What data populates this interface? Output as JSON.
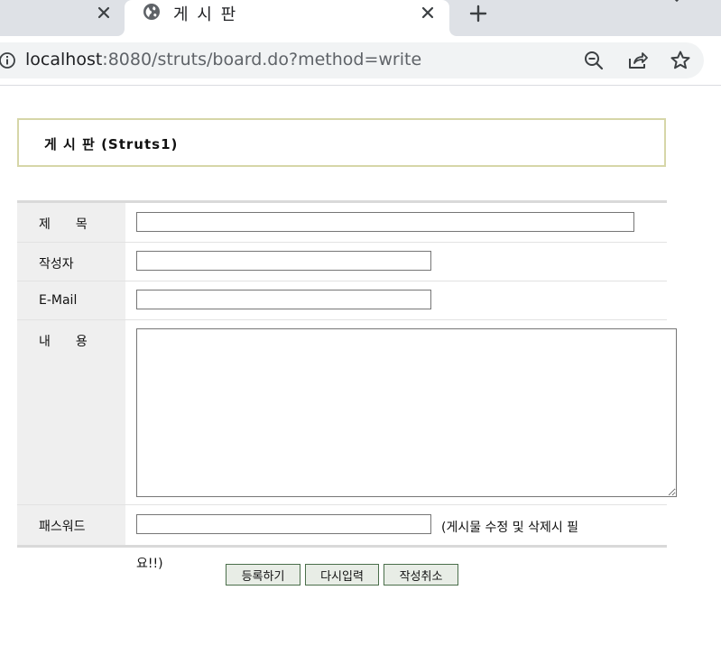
{
  "browser": {
    "tab_title": "게 시 판",
    "url_host": "localhost",
    "url_rest": ":8080/struts/board.do?method=write",
    "accent": "#202124",
    "icons": [
      "close-icon",
      "globe-icon",
      "plus-icon",
      "info-icon",
      "zoom-out-icon",
      "share-icon",
      "star-icon"
    ]
  },
  "board": {
    "title": "게 시 판 (Struts1)",
    "border_color": "#d6d6a8"
  },
  "form": {
    "title_label": "제　　목",
    "writer_label": "작성자",
    "email_label": "E-Mail",
    "content_label": "내　　용",
    "password_label": "패스워드",
    "title_value": "",
    "writer_value": "",
    "email_value": "",
    "content_value": "",
    "password_value": "",
    "password_note_line1": "(게시물 수정 및 삭제시 필",
    "password_note_line2": "요!!)"
  },
  "buttons": {
    "submit": "등록하기",
    "reset": "다시입력",
    "cancel": "작성취소"
  }
}
